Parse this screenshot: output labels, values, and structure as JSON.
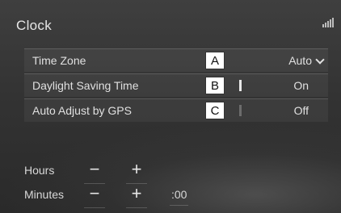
{
  "screen": {
    "title": "Clock"
  },
  "settings": [
    {
      "label": "Time Zone",
      "callout": "A",
      "value": "Auto"
    },
    {
      "label": "Daylight Saving Time",
      "callout": "B",
      "value": "On"
    },
    {
      "label": "Auto Adjust by GPS",
      "callout": "C",
      "value": "Off"
    }
  ],
  "adjust": {
    "hours_label": "Hours",
    "minutes_label": "Minutes",
    "minus": "−",
    "plus": "+",
    "seconds_reset": ":00"
  }
}
